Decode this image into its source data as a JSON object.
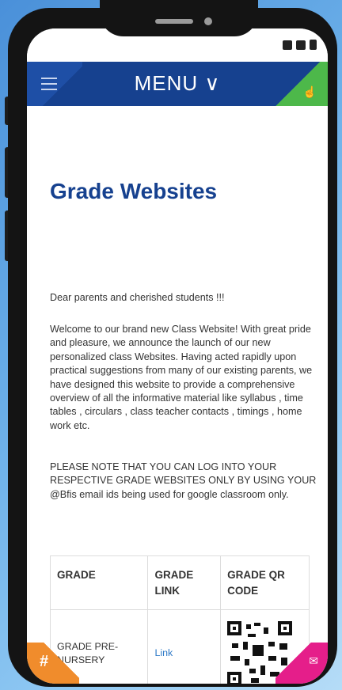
{
  "navbar": {
    "menu_label": "MENU ∨",
    "hamburger_icon": "hamburger-icon",
    "hand_icon": "hand-pointer-icon",
    "colors": {
      "bar": "#16418f",
      "accent_right": "#4db84a"
    }
  },
  "page": {
    "title": "Grade Websites",
    "greeting": "Dear parents and cherished students !!!",
    "welcome": "Welcome to our brand new Class Website! With great pride and pleasure, we announce the launch of our new personalized class Websites. Having acted rapidly upon practical suggestions from many of our existing parents, we have designed this website to provide a comprehensive overview of all the informative material like syllabus , time tables , circulars , class teacher contacts , timings , home work etc.",
    "notice": "PLEASE NOTE THAT YOU CAN LOG INTO YOUR RESPECTIVE GRADE WEBSITES ONLY BY USING YOUR @Bfis email ids being used for google classroom only."
  },
  "table": {
    "headers": [
      "GRADE",
      "GRADE LINK",
      "GRADE QR CODE"
    ],
    "rows": [
      {
        "grade": "GRADE PRE-NURSERY",
        "link": "Link",
        "qr_icon": "qr-code-icon"
      }
    ]
  },
  "floating": {
    "hash_label": "#",
    "mail_icon": "mail-icon",
    "colors": {
      "hash": "#f08c2c",
      "mail": "#e51e8a"
    }
  }
}
